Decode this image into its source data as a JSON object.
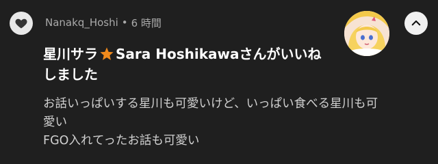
{
  "notification": {
    "icon": "heart-icon",
    "author": "Nanakq_Hoshi",
    "separator": "•",
    "time": "6 時間",
    "title_part1": "星川サラ",
    "title_star": "star-icon",
    "title_part2": "Sara Hoshikawa",
    "title_part3": "さんがいいね",
    "title_line2": "しました",
    "comment_lines": [
      "お話いっぱいする星川も可愛いけど、いっぱい食べる星川も可",
      "愛い",
      "FGO入れてったお話も可愛い"
    ],
    "avatar": "avatar-image",
    "collapse_icon": "chevron-up-icon"
  },
  "colors": {
    "background": "#1f1f1f",
    "badge": "#e8e8e8",
    "star": "#f08a1c",
    "meta_text": "#aaaaaa",
    "comment_text": "#d0d0d0"
  }
}
